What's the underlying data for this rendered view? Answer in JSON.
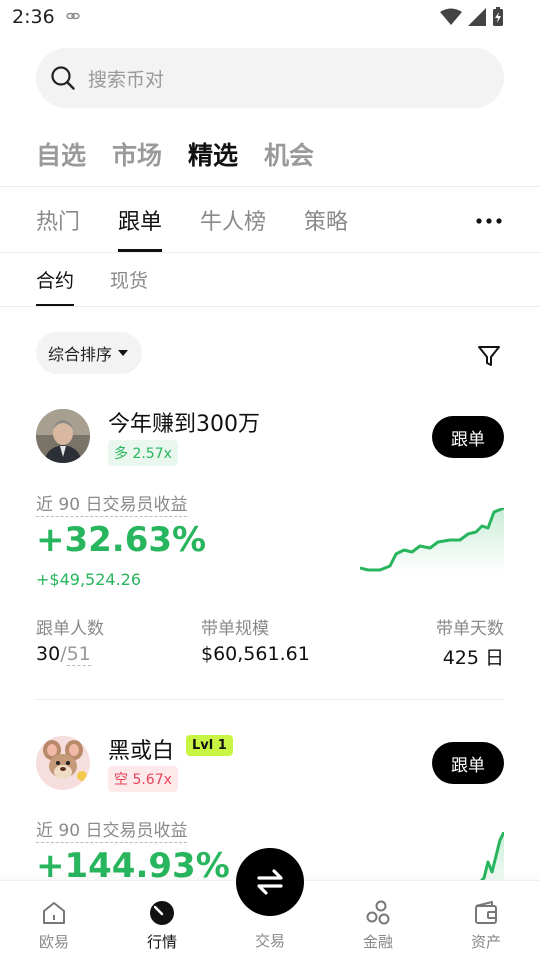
{
  "status_bar": {
    "time": "2:36"
  },
  "search": {
    "placeholder": "搜索币对"
  },
  "top_tabs": [
    {
      "label": "自选",
      "active": false
    },
    {
      "label": "市场",
      "active": false
    },
    {
      "label": "精选",
      "active": true
    },
    {
      "label": "机会",
      "active": false
    }
  ],
  "sub_tabs": [
    {
      "label": "热门",
      "active": false
    },
    {
      "label": "跟单",
      "active": true
    },
    {
      "label": "牛人榜",
      "active": false
    },
    {
      "label": "策略",
      "active": false
    }
  ],
  "third_tabs": [
    {
      "label": "合约",
      "active": true
    },
    {
      "label": "现货",
      "active": false
    }
  ],
  "sort": {
    "label": "综合排序"
  },
  "traders": [
    {
      "name": "今年赚到300万",
      "badge": "多 2.57x",
      "badge_type": "long",
      "follow_label": "跟单",
      "metric_label": "近 90 日交易员收益",
      "roi": "+32.63%",
      "pnl": "+$49,524.26",
      "stats": {
        "followers_label": "跟单人数",
        "followers_current": "30",
        "followers_sep": "/",
        "followers_max": "51",
        "aum_label": "带单规模",
        "aum_value": "$60,561.61",
        "days_label": "带单天数",
        "days_value": "425 日"
      }
    },
    {
      "name": "黑或白",
      "level": "Lvl 1",
      "badge": "空 5.67x",
      "badge_type": "short",
      "follow_label": "跟单",
      "metric_label": "近 90 日交易员收益",
      "roi": "+144.93%"
    }
  ],
  "bottom_nav": {
    "items": [
      {
        "label": "欧易",
        "icon": "home-icon"
      },
      {
        "label": "行情",
        "icon": "markets-icon",
        "active": true
      },
      {
        "label": "交易",
        "icon": "swap-icon"
      },
      {
        "label": "金融",
        "icon": "finance-icon"
      },
      {
        "label": "资产",
        "icon": "wallet-icon"
      }
    ]
  },
  "colors": {
    "accent_green": "#27b55d",
    "accent_red": "#e9445a",
    "level_badge": "#c8f543"
  }
}
